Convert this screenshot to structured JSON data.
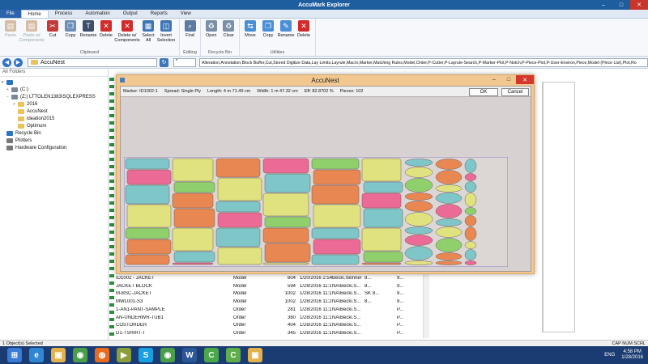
{
  "app": {
    "title": "AccuMark Explorer"
  },
  "tabs": [
    {
      "label": "File"
    },
    {
      "label": "Home"
    },
    {
      "label": "Process"
    },
    {
      "label": "Automation"
    },
    {
      "label": "Output"
    },
    {
      "label": "Reports"
    },
    {
      "label": "View"
    }
  ],
  "ribbon": {
    "clipboard": {
      "label": "Clipboard",
      "buttons": [
        "Paste",
        "Paste w/ Components",
        "Cut",
        "Copy",
        "Rename",
        "Delete",
        "Delete w/ Components",
        "Select All",
        "Invert Selection"
      ]
    },
    "editing": {
      "label": "Editing",
      "buttons": [
        "Find"
      ]
    },
    "recycle": {
      "label": "Recycle Bin",
      "buttons": [
        "Open",
        "Clear"
      ]
    },
    "utilities": {
      "label": "Utilities",
      "buttons": [
        "Move",
        "Copy",
        "Rename",
        "Delete"
      ]
    }
  },
  "address": {
    "path": "AccuNest",
    "filter": "*",
    "datatypes": "Alteration,Annotation,Block Buffer,Cut,Stored Digitize Data,Lay Limits,Layrule,Macro,Marker,Matching Rules,Model,Order,P-Cutter,P-Layrule-Search,P-Marker-Plot,P-Notch,P-Piece-Plot,P-User-Environ,Piece,Model (Piece List),Plot,Ro"
  },
  "left_panel": {
    "title": "All Folders",
    "tree": [
      {
        "label": "(C:)"
      },
      {
        "label": "(Z:) LTTOLEN1383\\SQLEXPRESS"
      },
      {
        "label": "2016"
      },
      {
        "label": "AccuNest"
      },
      {
        "label": "ideation2015"
      },
      {
        "label": "Optimum"
      },
      {
        "label": "Recycle Bin"
      },
      {
        "label": "Plotters"
      },
      {
        "label": "Hardware Configuration"
      }
    ]
  },
  "files": [
    {
      "name": "ID1002 - JACKET",
      "type": "Model",
      "size": "604",
      "date": "1/20/2016 2:54...",
      "user": "Becki.Skinner",
      "a": "8...",
      "b": "",
      "c": "9..."
    },
    {
      "name": "JACKET BLOCK",
      "type": "Model",
      "size": "594",
      "date": "1/28/2016 11:1...",
      "user": "NA\\Becki.S...",
      "a": "8...",
      "b": "",
      "c": "9..."
    },
    {
      "name": "M-BSC-JACKET",
      "type": "Model",
      "size": "1002",
      "date": "1/28/2016 11:1...",
      "user": "NA\\Becki.S...",
      "a": "SK",
      "b": "8...",
      "c": "9..."
    },
    {
      "name": "MWL001-S3",
      "type": "Model",
      "size": "1002",
      "date": "1/28/2016 11:2...",
      "user": "NA\\Becki.S...",
      "a": "8...",
      "b": "",
      "c": "9..."
    },
    {
      "name": "1-AN1-PANT-SAMPLE",
      "type": "Order",
      "size": "281",
      "date": "1/28/2016 11:1...",
      "user": "NA\\Becki.S...",
      "a": "",
      "b": "",
      "c": "P..."
    },
    {
      "name": "AN-UNDERWR-TUB1",
      "type": "Order",
      "size": "380",
      "date": "1/28/2016 11:1...",
      "user": "NA\\Becki.S...",
      "a": "",
      "b": "",
      "c": "P..."
    },
    {
      "name": "COSTORDER",
      "type": "Order",
      "size": "404",
      "date": "1/28/2016 11:1...",
      "user": "NA\\Becki.S...",
      "a": "",
      "b": "",
      "c": "P..."
    },
    {
      "name": "D1-TSHIRT-T",
      "type": "Order",
      "size": "345",
      "date": "1/28/2016 11:1...",
      "user": "NA\\Becki.S...",
      "a": "",
      "b": "",
      "c": "P..."
    }
  ],
  "dialog": {
    "title": "AccuNest",
    "marker": "Marker: ID1002-1",
    "spread": "Spread: Single Ply",
    "length": "Length: 4 m 71.49 cm",
    "width": "Width: 1 m 47.32 cm",
    "eff": "Eff: 82.8702 %",
    "pieces": "Pieces: 102",
    "ok": "OK",
    "cancel": "Cancel"
  },
  "status": {
    "left": "1 Object(s) Selected",
    "right": "CAP  NUM  SCRL"
  },
  "taskbar": {
    "apps": [
      "windows-start",
      "ie",
      "explorer",
      "chrome",
      "firefox",
      "media",
      "skype",
      "chrome2",
      "word",
      "accumark",
      "accumark2",
      "explorer2"
    ],
    "lang": "ENG",
    "time": "4:58 PM",
    "date": "1/28/2016"
  },
  "colors": {
    "title_bar": "#1f5e9e",
    "dialog_frame": "#f2c890",
    "marker_bg": "#d7d2d1",
    "taskbar": "#1b3c72"
  }
}
